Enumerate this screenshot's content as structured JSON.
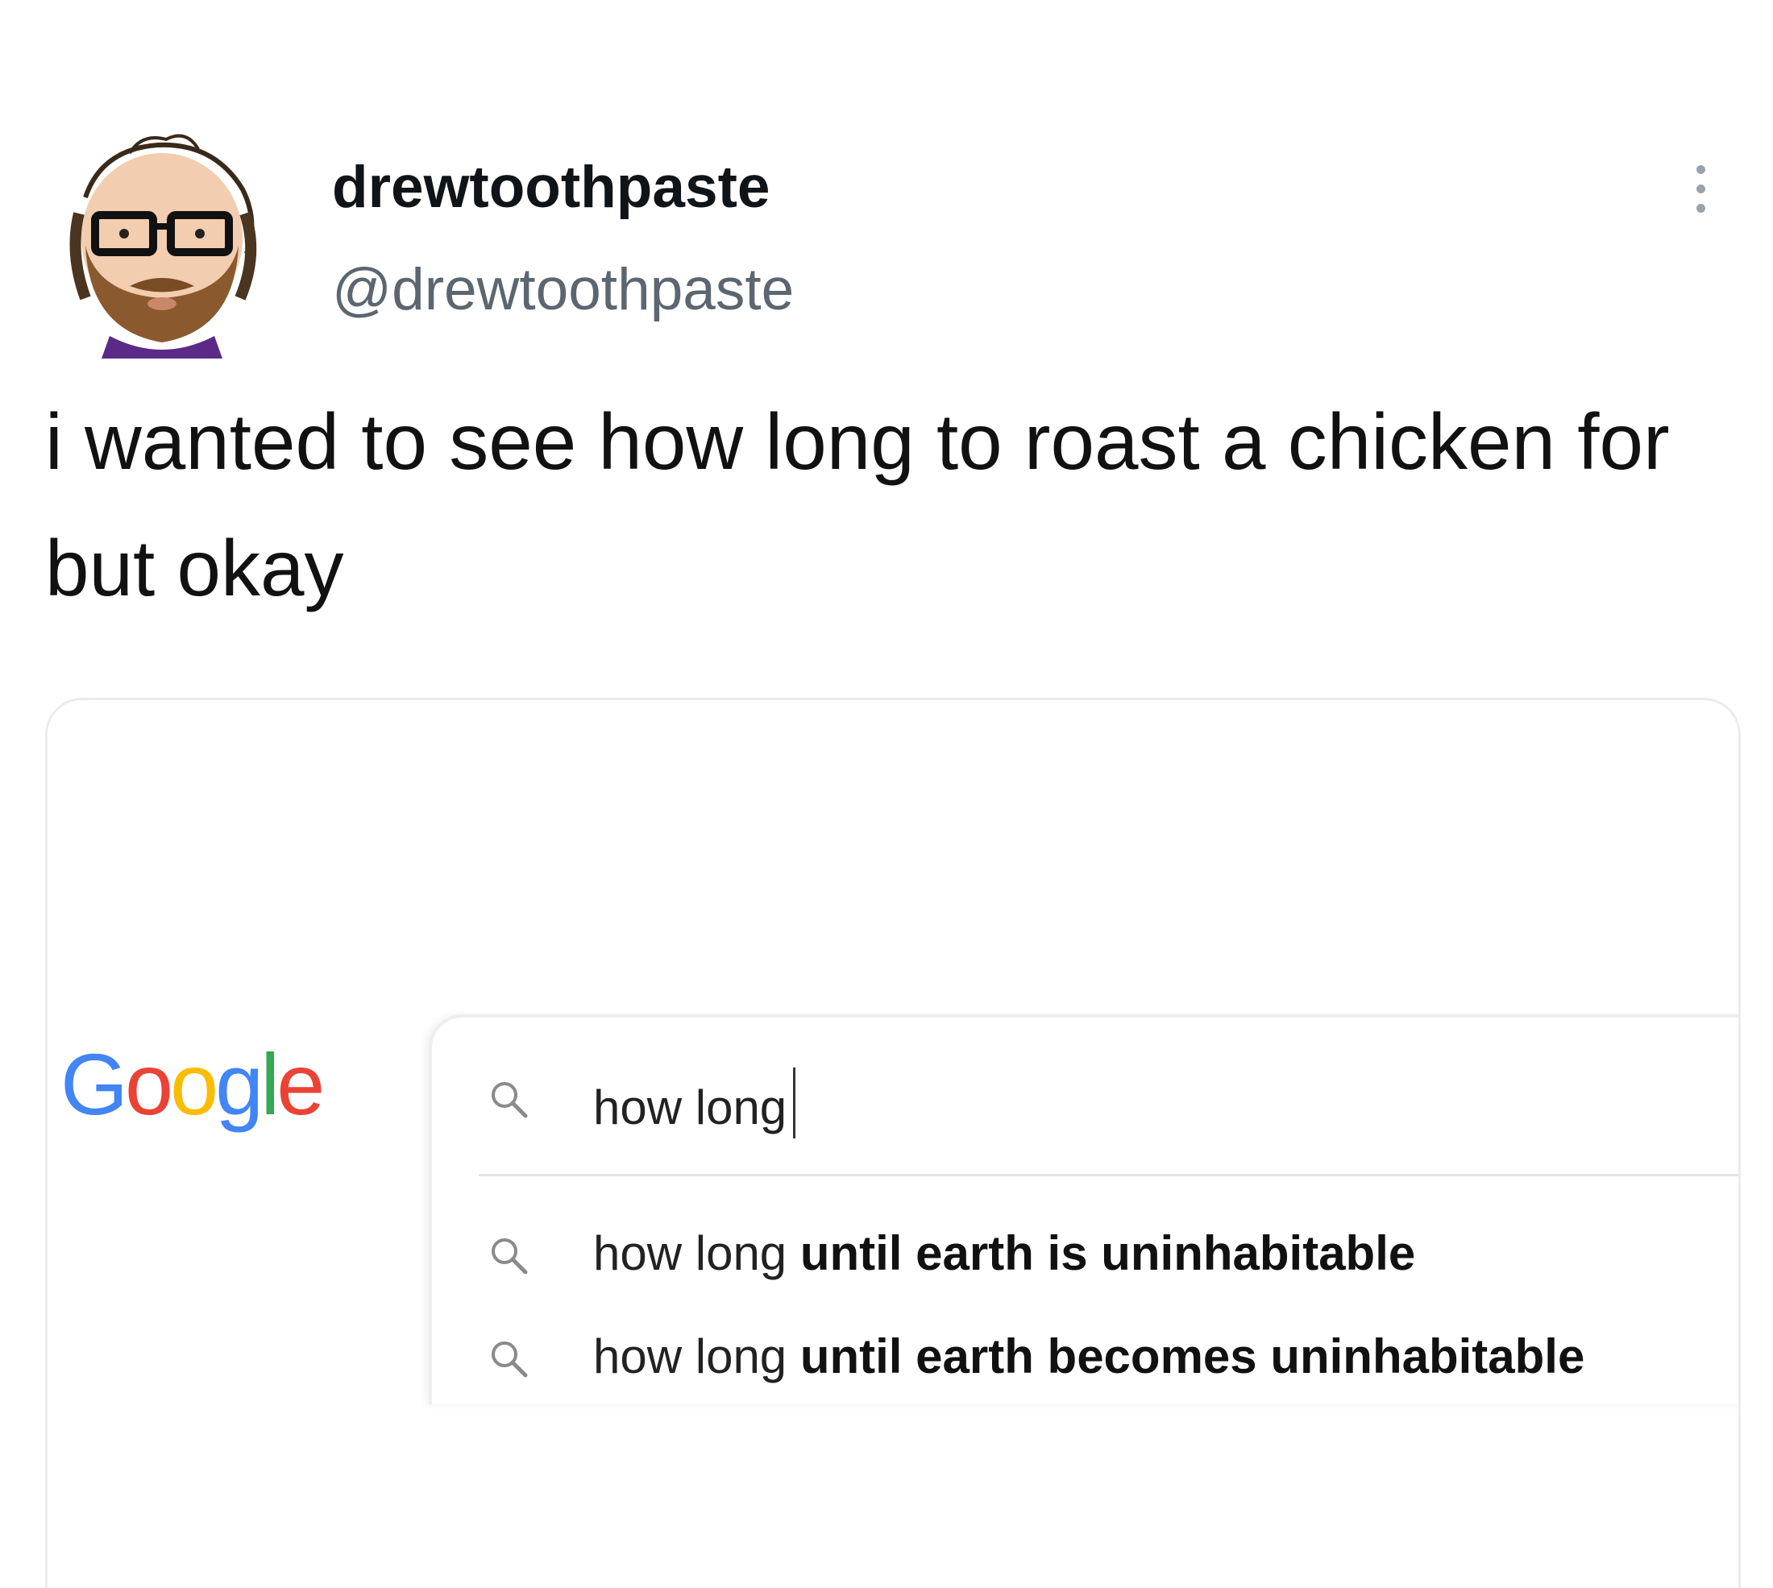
{
  "tweet": {
    "display_name": "drewtoothpaste",
    "handle": "@drewtoothpaste",
    "text": "i wanted to see how long to roast a chicken for but okay"
  },
  "icons": {
    "avatar": "bearded-man-with-glasses-avatar",
    "more": "more-vertical-dots-icon",
    "search": "search-icon"
  },
  "google": {
    "logo_letters": [
      "G",
      "o",
      "o",
      "g",
      "l",
      "e"
    ],
    "logo_colors": [
      "#4285f4",
      "#ea4335",
      "#fbbc05",
      "#4285f4",
      "#34a853",
      "#ea4335"
    ],
    "search_query": "how long",
    "suggestions": [
      {
        "prefix": "how long",
        "completion": "until earth is uninhabitable"
      },
      {
        "prefix": "how long",
        "completion": "until earth becomes uninhabitable"
      }
    ]
  }
}
